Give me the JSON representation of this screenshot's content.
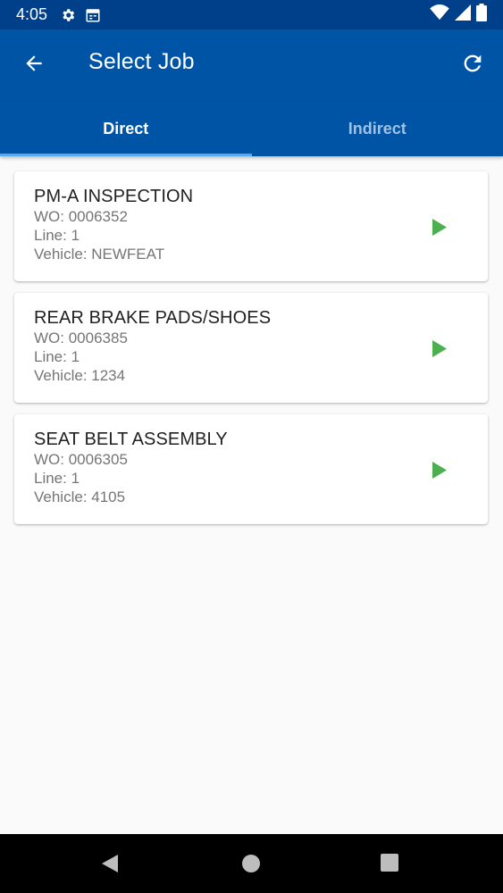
{
  "status_bar": {
    "time": "4:05",
    "icons_left": [
      "gear-icon",
      "calendar-icon"
    ],
    "icons_right": [
      "wifi-icon",
      "signal-icon",
      "battery-icon"
    ]
  },
  "app_bar": {
    "title": "Select Job",
    "back_icon": "arrow-back-icon",
    "refresh_icon": "refresh-icon"
  },
  "tabs": [
    {
      "label": "Direct",
      "active": true
    },
    {
      "label": "Indirect",
      "active": false
    }
  ],
  "jobs": [
    {
      "title": "PM-A INSPECTION",
      "wo": "WO: 0006352",
      "line": "Line: 1",
      "vehicle": "Vehicle: NEWFEAT"
    },
    {
      "title": "REAR BRAKE PADS/SHOES",
      "wo": "WO: 0006385",
      "line": "Line: 1",
      "vehicle": "Vehicle: 1234"
    },
    {
      "title": "SEAT BELT ASSEMBLY",
      "wo": "WO: 0006305",
      "line": "Line: 1",
      "vehicle": "Vehicle: 4105"
    }
  ],
  "colors": {
    "status_bar": "#003f8a",
    "app_bar": "#0054a6",
    "tab_indicator": "#5aa9ee",
    "play": "#4caf50"
  }
}
